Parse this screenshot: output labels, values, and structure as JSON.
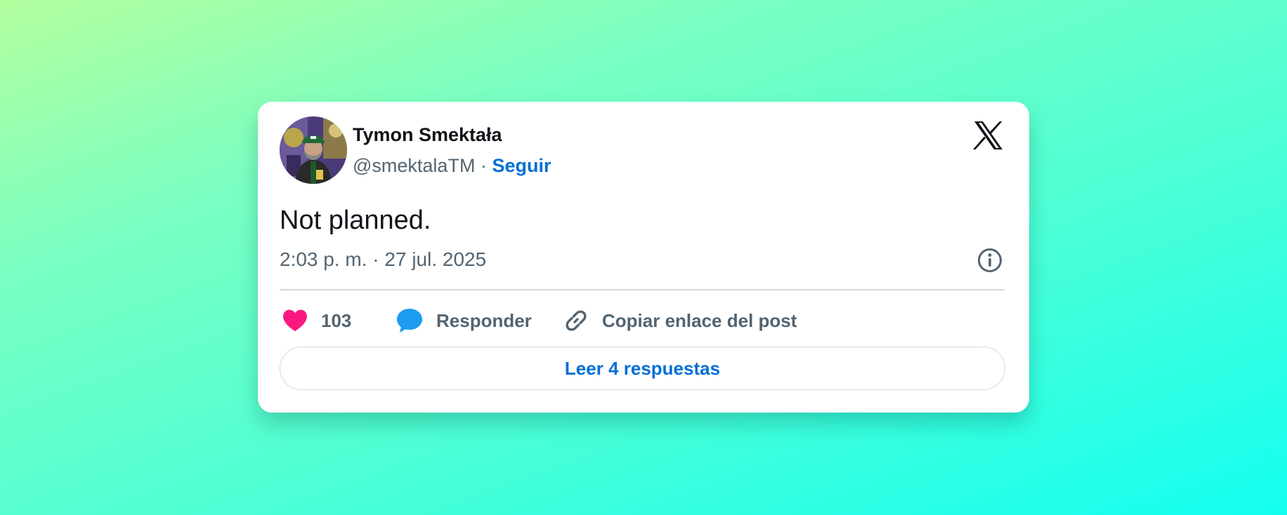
{
  "tweet": {
    "author_name": "Tymon Smektała",
    "handle": "@smektalaTM",
    "separator": " · ",
    "follow_label": "Seguir",
    "text": "Not planned.",
    "timestamp": "2:03 p. m. · 27 jul. 2025",
    "likes": "103",
    "reply_label": "Responder",
    "copy_link_label": "Copiar enlace del post",
    "read_replies_label": "Leer 4 respuestas"
  },
  "icons": {
    "brand": "x-logo-icon",
    "info": "info-icon",
    "like": "heart-icon",
    "reply": "speech-bubble-icon",
    "copy": "link-icon"
  },
  "colors": {
    "link_blue": "#006fd6",
    "heart_pink": "#f91880",
    "reply_blue": "#1d9bf0",
    "text_primary": "#0f1419",
    "text_secondary": "#536471"
  }
}
